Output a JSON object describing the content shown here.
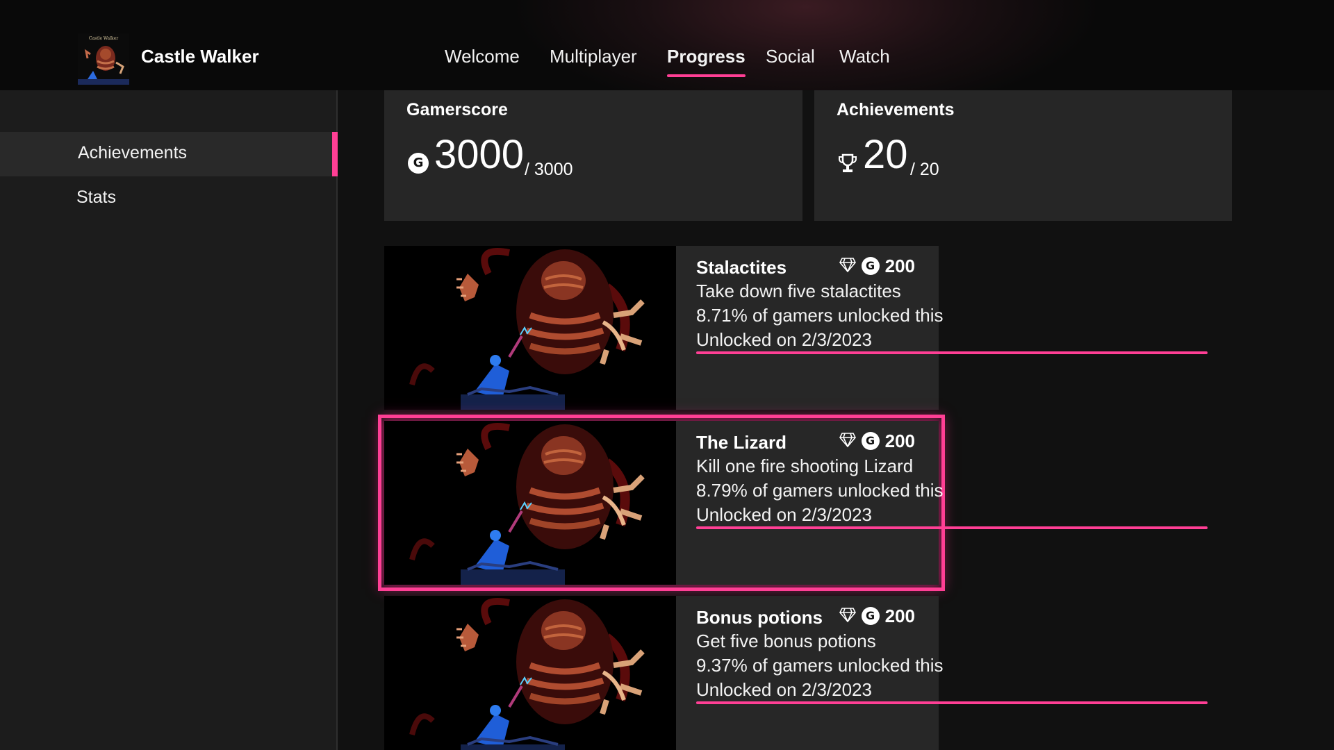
{
  "accent": "#ff3f95",
  "header": {
    "game_title": "Castle Walker",
    "thumb_caption": "Castle Walker",
    "tabs": [
      {
        "label": "Welcome",
        "active": false
      },
      {
        "label": "Multiplayer",
        "active": false
      },
      {
        "label": "Progress",
        "active": true
      },
      {
        "label": "Social",
        "active": false
      },
      {
        "label": "Watch",
        "active": false
      }
    ]
  },
  "sidebar": {
    "items": [
      {
        "label": "Achievements",
        "selected": true
      },
      {
        "label": "Stats",
        "selected": false
      }
    ]
  },
  "summary": {
    "gamerscore": {
      "title": "Gamerscore",
      "value": "3000",
      "total": "/ 3000",
      "icon": "gamerscore-icon"
    },
    "achievements": {
      "title": "Achievements",
      "value": "20",
      "total": "/ 20",
      "icon": "trophy-icon"
    }
  },
  "achievements": [
    {
      "name": "Stalactites",
      "description": "Take down five stalactites",
      "rarity": "8.71% of gamers unlocked this",
      "unlocked": "Unlocked on 2/3/2023",
      "score": "200",
      "progress": 1.0,
      "focused": false
    },
    {
      "name": "The Lizard",
      "description": "Kill one fire shooting Lizard",
      "rarity": "8.79% of gamers unlocked this",
      "unlocked": "Unlocked on 2/3/2023",
      "score": "200",
      "progress": 1.0,
      "focused": true
    },
    {
      "name": "Bonus potions",
      "description": "Get five bonus potions",
      "rarity": "9.37% of gamers unlocked this",
      "unlocked": "Unlocked on 2/3/2023",
      "score": "200",
      "progress": 1.0,
      "focused": false
    }
  ]
}
